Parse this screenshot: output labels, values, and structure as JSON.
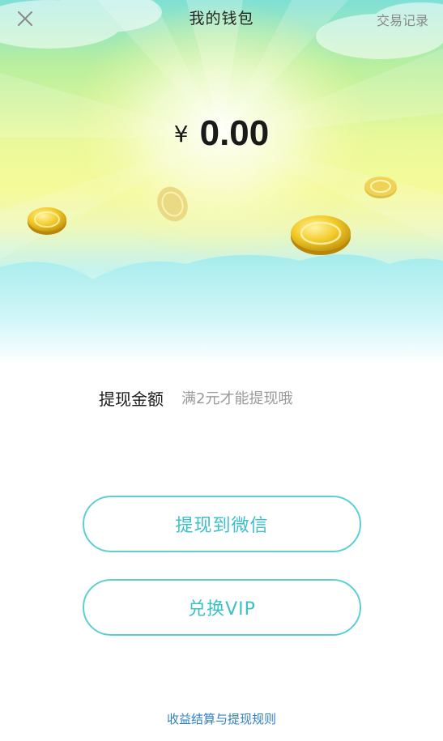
{
  "header": {
    "title": "我的钱包",
    "history_label": "交易记录",
    "close_icon": "close-icon"
  },
  "balance": {
    "currency": "¥",
    "amount": "0.00"
  },
  "withdraw": {
    "label": "提现金额",
    "hint": "满2元才能提现哦"
  },
  "actions": {
    "withdraw_wechat_label": "提现到微信",
    "exchange_vip_label": "兑换VIP"
  },
  "footer": {
    "rules_label": "收益结算与提现规则"
  },
  "colors": {
    "accent": "#3cc0c8",
    "button_border": "#5ccfd2",
    "link": "#2f7fc4",
    "coin": "#f2c62a"
  }
}
